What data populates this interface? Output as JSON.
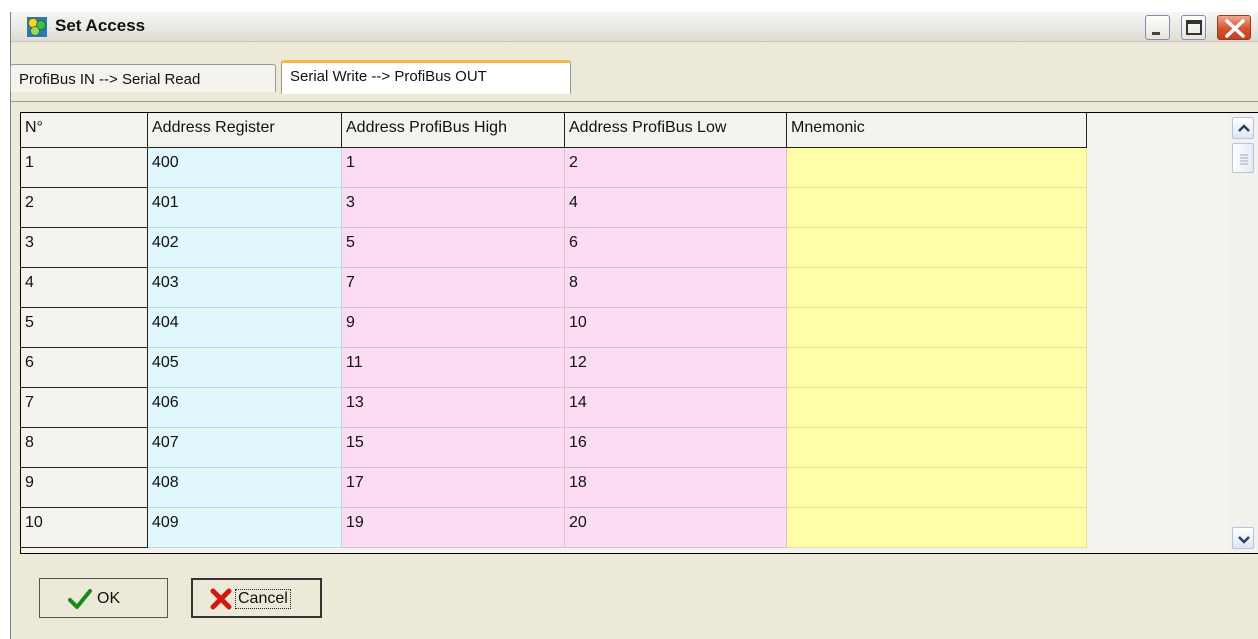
{
  "window": {
    "title": "Set Access"
  },
  "tabs": [
    {
      "label": "ProfiBus IN --> Serial Read",
      "active": false
    },
    {
      "label": "Serial Write --> ProfiBus OUT",
      "active": true
    }
  ],
  "grid": {
    "columns": [
      "N°",
      "Address Register",
      "Address ProfiBus High",
      "Address ProfiBus Low",
      "Mnemonic"
    ],
    "rows": [
      [
        "1",
        "400",
        "1",
        "2",
        ""
      ],
      [
        "2",
        "401",
        "3",
        "4",
        ""
      ],
      [
        "3",
        "402",
        "5",
        "6",
        ""
      ],
      [
        "4",
        "403",
        "7",
        "8",
        ""
      ],
      [
        "5",
        "404",
        "9",
        "10",
        ""
      ],
      [
        "6",
        "405",
        "11",
        "12",
        ""
      ],
      [
        "7",
        "406",
        "13",
        "14",
        ""
      ],
      [
        "8",
        "407",
        "15",
        "16",
        ""
      ],
      [
        "9",
        "408",
        "17",
        "18",
        ""
      ],
      [
        "10",
        "409",
        "19",
        "20",
        ""
      ]
    ],
    "colors": {
      "register": "#e0f7fb",
      "profibus": "#fbdcf2",
      "mnemonic": "#fefea8"
    }
  },
  "buttons": {
    "ok": "OK",
    "cancel": "Cancel"
  },
  "icons": {
    "app": "app-icon",
    "minimize": "minimize-icon",
    "maximize": "maximize-icon",
    "close": "close-icon",
    "ok": "checkmark-icon",
    "cancel": "red-x-icon",
    "scroll_up": "chevron-up-icon",
    "scroll_down": "chevron-down-icon"
  }
}
